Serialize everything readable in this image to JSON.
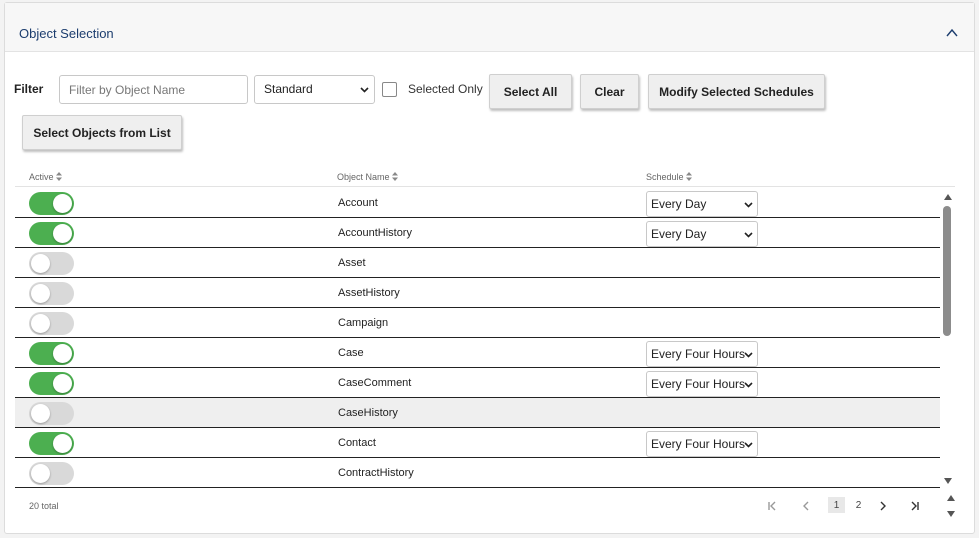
{
  "panel": {
    "title": "Object Selection"
  },
  "filter": {
    "label": "Filter",
    "placeholder": "Filter by Object Name",
    "value": "",
    "type_selected": "Standard",
    "selected_only_label": "Selected Only",
    "selected_only_checked": false
  },
  "buttons": {
    "select_all": "Select All",
    "clear": "Clear",
    "modify": "Modify Selected Schedules",
    "select_from_list": "Select Objects from List"
  },
  "columns": {
    "active": "Active",
    "object_name": "Object Name",
    "schedule": "Schedule"
  },
  "rows": [
    {
      "active": true,
      "name": "Account",
      "schedule": "Every Day"
    },
    {
      "active": true,
      "name": "AccountHistory",
      "schedule": "Every Day"
    },
    {
      "active": false,
      "name": "Asset",
      "schedule": ""
    },
    {
      "active": false,
      "name": "AssetHistory",
      "schedule": ""
    },
    {
      "active": false,
      "name": "Campaign",
      "schedule": ""
    },
    {
      "active": true,
      "name": "Case",
      "schedule": "Every Four Hours"
    },
    {
      "active": true,
      "name": "CaseComment",
      "schedule": "Every Four Hours"
    },
    {
      "active": false,
      "name": "CaseHistory",
      "schedule": "",
      "highlighted": true
    },
    {
      "active": true,
      "name": "Contact",
      "schedule": "Every Four Hours"
    },
    {
      "active": false,
      "name": "ContractHistory",
      "schedule": ""
    }
  ],
  "footer": {
    "total": "20 total",
    "pages": [
      "1",
      "2"
    ],
    "current_page": "1"
  },
  "colors": {
    "toggle_on": "#4caf50",
    "toggle_off": "#d9d9d9",
    "title": "#1c3d6e"
  },
  "icons": {
    "collapse": "chevron-up-icon",
    "select": "chevron-down-icon",
    "sort": "sort-icon",
    "first": "first-page-icon",
    "prev": "prev-page-icon",
    "next": "next-page-icon",
    "last": "last-page-icon"
  }
}
